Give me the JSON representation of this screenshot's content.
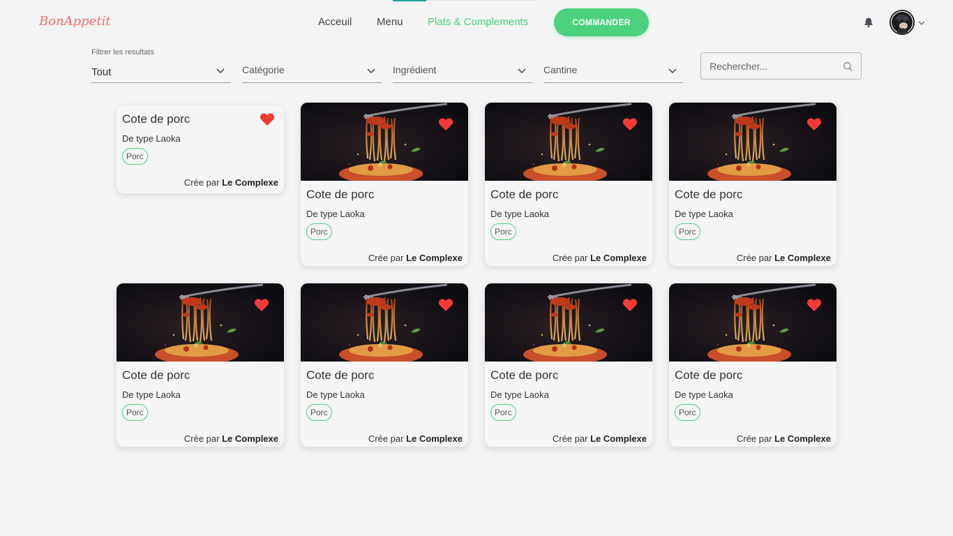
{
  "header": {
    "logo": "BonAppetit",
    "nav": [
      {
        "label": "Acceuil",
        "active": false
      },
      {
        "label": "Menu",
        "active": false
      },
      {
        "label": "Plats & Complements",
        "active": true
      }
    ],
    "cta_label": "COMMANDER",
    "icons": {
      "notifications": "bell-icon",
      "account_menu": "chevron-down-icon"
    }
  },
  "filters": {
    "caption": "Filtrer les resultats",
    "selects": [
      {
        "label": "Tout",
        "is_value": true
      },
      {
        "label": "Catégorie",
        "is_value": false
      },
      {
        "label": "Ingrédient",
        "is_value": false
      },
      {
        "label": "Cantine",
        "is_value": false
      }
    ],
    "search": {
      "placeholder": "Rechercher...",
      "value": ""
    }
  },
  "colors": {
    "accent": "#4cd17f",
    "brand": "#ee6e6e",
    "favorite": "#f23b35",
    "nav_indicator": "#17a398",
    "background": "#f4f4f4"
  },
  "cards": [
    {
      "title": "Cote de porc",
      "type": "De type Laoka",
      "tag": "Porc",
      "author_prefix": "Crée par",
      "author": "Le Complexe",
      "has_image": false,
      "favorite": true
    },
    {
      "title": "Cote de porc",
      "type": "De type Laoka",
      "tag": "Porc",
      "author_prefix": "Crée par",
      "author": "Le Complexe",
      "has_image": true,
      "favorite": true
    },
    {
      "title": "Cote de porc",
      "type": "De type Laoka",
      "tag": "Porc",
      "author_prefix": "Crée par",
      "author": "Le Complexe",
      "has_image": true,
      "favorite": true
    },
    {
      "title": "Cote de porc",
      "type": "De type Laoka",
      "tag": "Porc",
      "author_prefix": "Crée par",
      "author": "Le Complexe",
      "has_image": true,
      "favorite": true
    },
    {
      "title": "Cote de porc",
      "type": "De type Laoka",
      "tag": "Porc",
      "author_prefix": "Crée par",
      "author": "Le Complexe",
      "has_image": true,
      "favorite": true
    },
    {
      "title": "Cote de porc",
      "type": "De type Laoka",
      "tag": "Porc",
      "author_prefix": "Crée par",
      "author": "Le Complexe",
      "has_image": true,
      "favorite": true
    },
    {
      "title": "Cote de porc",
      "type": "De type Laoka",
      "tag": "Porc",
      "author_prefix": "Crée par",
      "author": "Le Complexe",
      "has_image": true,
      "favorite": true
    },
    {
      "title": "Cote de porc",
      "type": "De type Laoka",
      "tag": "Porc",
      "author_prefix": "Crée par",
      "author": "Le Complexe",
      "has_image": true,
      "favorite": true
    }
  ]
}
